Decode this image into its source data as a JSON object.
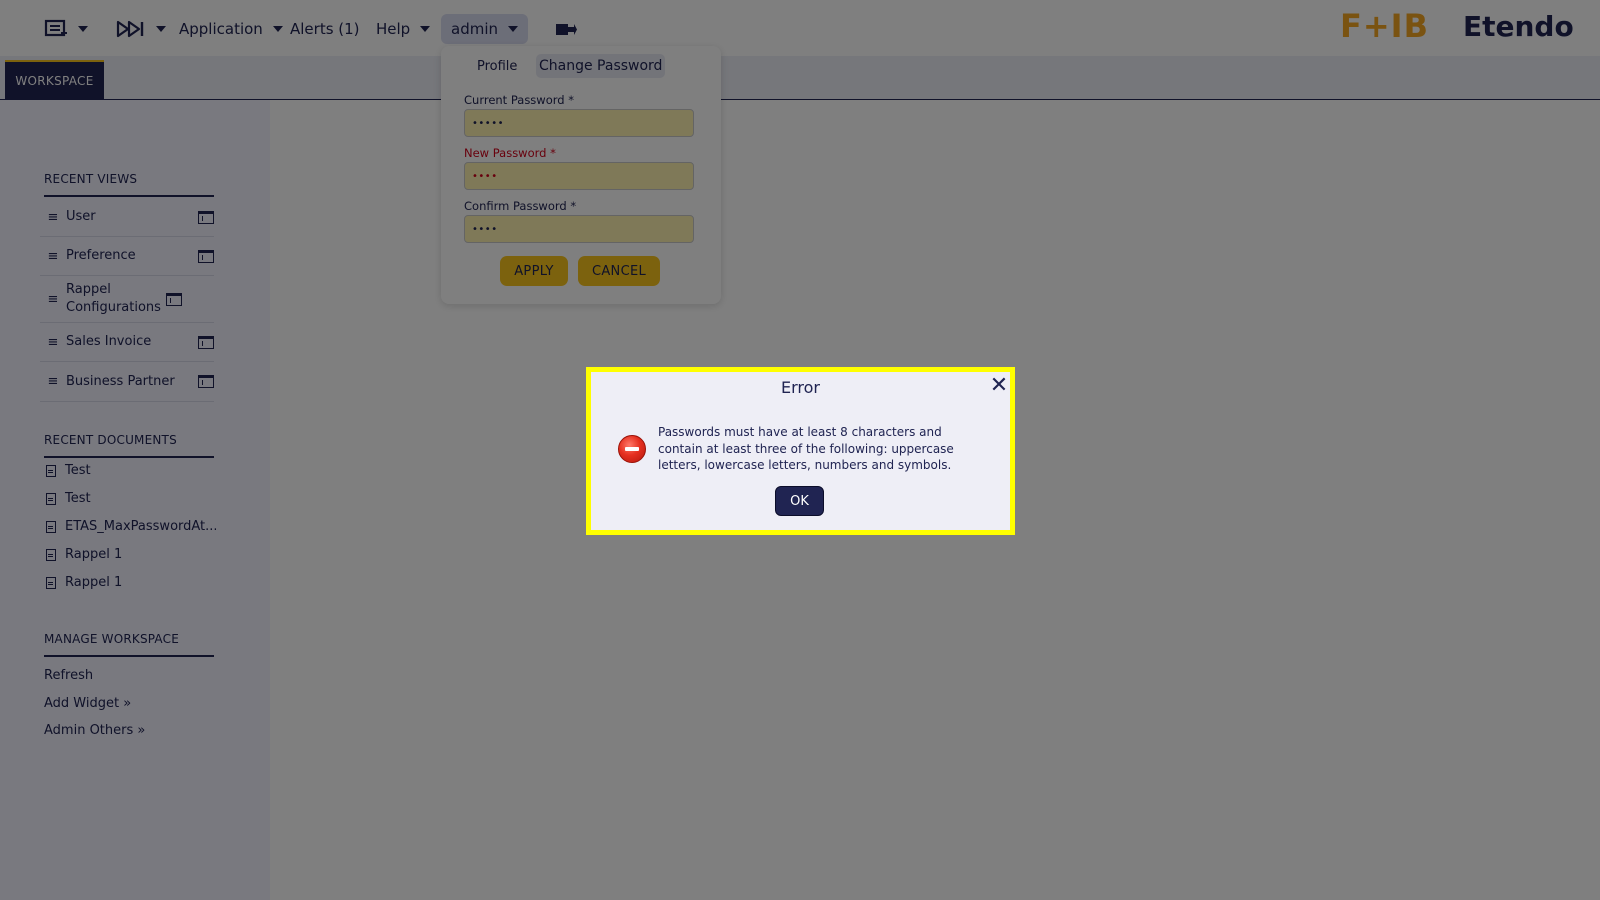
{
  "topbar": {
    "application_label": "Application",
    "alerts_label": "Alerts (1)",
    "help_label": "Help",
    "user_label": "admin",
    "logo_text": "F+IB",
    "brand_text": "Etendo"
  },
  "tabs": {
    "workspace_label": "WORKSPACE"
  },
  "sidebar": {
    "recent_views_title": "RECENT VIEWS",
    "recent_views": [
      {
        "label": "User"
      },
      {
        "label": "Preference"
      },
      {
        "label": "Rappel Configurations"
      },
      {
        "label": "Sales Invoice"
      },
      {
        "label": "Business Partner"
      }
    ],
    "recent_documents_title": "RECENT DOCUMENTS",
    "recent_documents": [
      {
        "label": "Test"
      },
      {
        "label": "Test"
      },
      {
        "label": "ETAS_MaxPasswordAt..."
      },
      {
        "label": "Rappel 1"
      },
      {
        "label": "Rappel 1"
      }
    ],
    "manage_workspace_title": "MANAGE WORKSPACE",
    "manage_links": [
      {
        "label": "Refresh"
      },
      {
        "label": "Add Widget »"
      },
      {
        "label": "Admin Others »"
      }
    ]
  },
  "profile_dropdown": {
    "tab_profile": "Profile",
    "tab_change_password": "Change Password",
    "current_password_label": "Current Password *",
    "current_password_value": "•••••",
    "new_password_label": "New Password *",
    "new_password_value": "••••",
    "confirm_password_label": "Confirm Password *",
    "confirm_password_value": "••••",
    "apply_label": "APPLY",
    "cancel_label": "CANCEL"
  },
  "error_dialog": {
    "title": "Error",
    "close_glyph": "✕",
    "message": "Passwords must have at least 8 characters and contain at least three of the following: uppercase letters, lowercase letters, numbers and symbols.",
    "ok_label": "OK"
  },
  "colors": {
    "primary": "#202452",
    "accent": "#f9c51d",
    "highlight_border": "#ffff00",
    "error_red": "#d0021b"
  }
}
